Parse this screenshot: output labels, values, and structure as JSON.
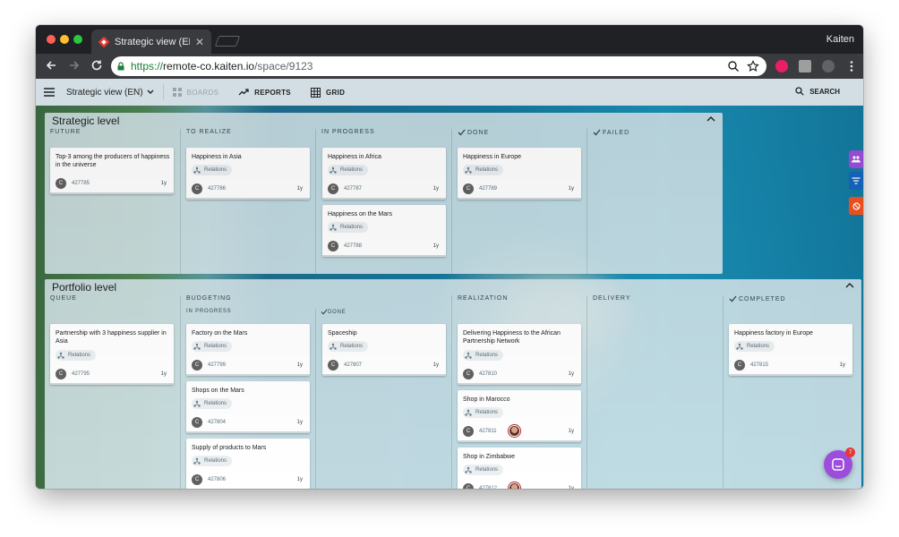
{
  "browser": {
    "tab_title": "Strategic view (EN) | K",
    "tab_close": "✕",
    "profile_name": "Kaiten",
    "url_scheme": "https://",
    "url_host": "remote-co.kaiten.io",
    "url_path": "/space/9123"
  },
  "appbar": {
    "space_title": "Strategic view (EN)",
    "boards_label": "BOARDS",
    "reports_label": "REPORTS",
    "grid_label": "GRID",
    "search_label": "SEARCH"
  },
  "strategic": {
    "title": "Strategic level",
    "columns": [
      "FUTURE",
      "TO REALIZE",
      "IN PROGRESS",
      "DONE",
      "FAILED"
    ],
    "cards": [
      {
        "title": "Top-3 among the producers of happiness in the universe",
        "id": "427785",
        "age": "1y"
      },
      {
        "title": "Happiness in Asia",
        "chip": "Relations",
        "id": "427786",
        "age": "1y"
      },
      {
        "title": "Happiness in Africa",
        "chip": "Relations",
        "id": "427787",
        "age": "1y"
      },
      {
        "title": "Happiness on the Mars",
        "chip": "Relations",
        "id": "427788",
        "age": "1y"
      },
      {
        "title": "Happiness in Europe",
        "chip": "Relations",
        "id": "427789",
        "age": "1y"
      }
    ]
  },
  "portfolio": {
    "title": "Portfolio level",
    "columns": [
      "QUEUE",
      "BUDGETING",
      "REALIZATION",
      "DELIVERY",
      "COMPLETED"
    ],
    "subcolumns": [
      "IN PROGRESS",
      "DONE"
    ],
    "cards": [
      {
        "title": "Partnership with 3 happiness supplier in Asia",
        "chip": "Relations",
        "id": "427795",
        "age": "1y"
      },
      {
        "title": "Factory on the Mars",
        "chip": "Relations",
        "id": "427799",
        "age": "1y"
      },
      {
        "title": "Shops on the Mars",
        "chip": "Relations",
        "id": "427804",
        "age": "1y"
      },
      {
        "title": "Supply of products to Mars",
        "chip": "Relations",
        "id": "427806",
        "age": "1y"
      },
      {
        "title": "Spaceship",
        "chip": "Relations",
        "id": "427807",
        "age": "1y"
      },
      {
        "title": "Delivering Happiness to the African Partnership Network",
        "chip": "Relations",
        "id": "427810",
        "age": "1y"
      },
      {
        "title": "Shop in Marocco",
        "chip": "Relations",
        "id": "427811",
        "age": "1y"
      },
      {
        "title": "Shop in Zimbabwe",
        "chip": "Relations",
        "id": "427812",
        "age": "1y"
      },
      {
        "title": "Happiness factory in Europe",
        "chip": "Relations",
        "id": "427815",
        "age": "1y"
      }
    ]
  },
  "avatar_letter": "C",
  "chat_badge": "7",
  "colors": {
    "accent_purple": "#9c4ddc",
    "side_blue": "#1565c0",
    "side_orange": "#f4511e",
    "secure_green": "#188038"
  }
}
